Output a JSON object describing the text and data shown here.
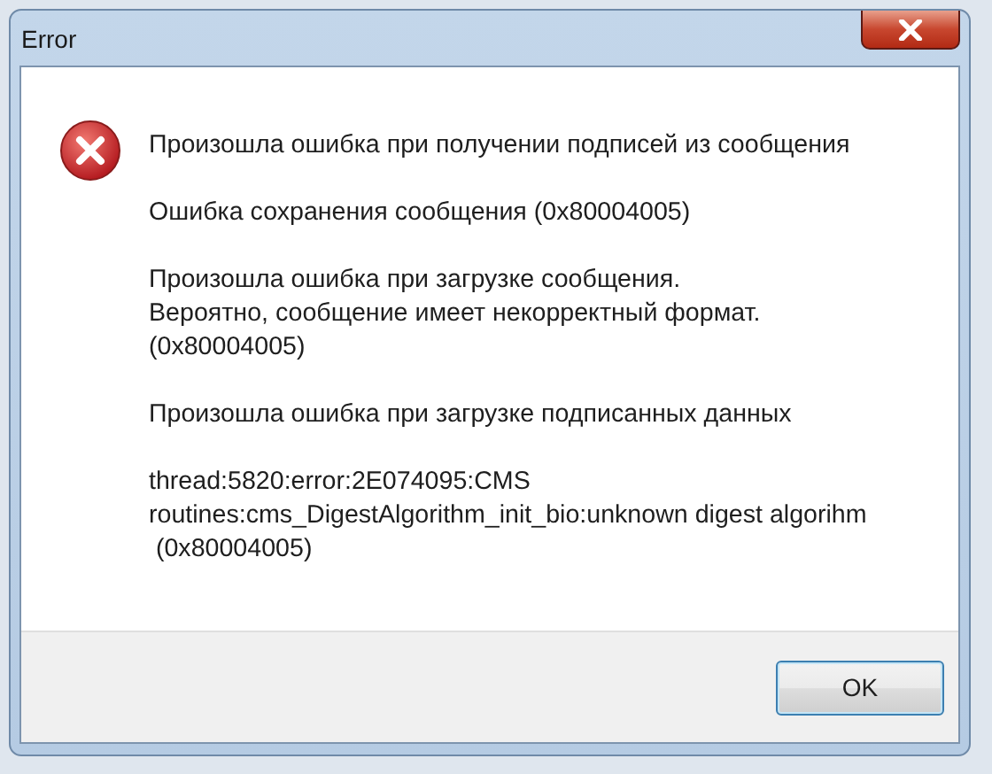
{
  "window": {
    "title": "Error"
  },
  "message": {
    "paragraphs": [
      {
        "lines": [
          "Произошла ошибка при получении подписей из сообщения"
        ]
      },
      {
        "lines": [
          "Ошибка сохранения сообщения (0x80004005)"
        ]
      },
      {
        "lines": [
          "Произошла ошибка при загрузке сообщения.",
          "Вероятно, сообщение имеет некорректный формат.",
          "(0x80004005)"
        ]
      },
      {
        "lines": [
          "Произошла ошибка при загрузке подписанных данных"
        ]
      },
      {
        "lines": [
          "thread:5820:error:2E074095:CMS",
          "routines:cms_DigestAlgorithm_init_bio:unknown digest algorihm",
          " (0x80004005)"
        ]
      }
    ]
  },
  "buttons": [
    "OK"
  ]
}
